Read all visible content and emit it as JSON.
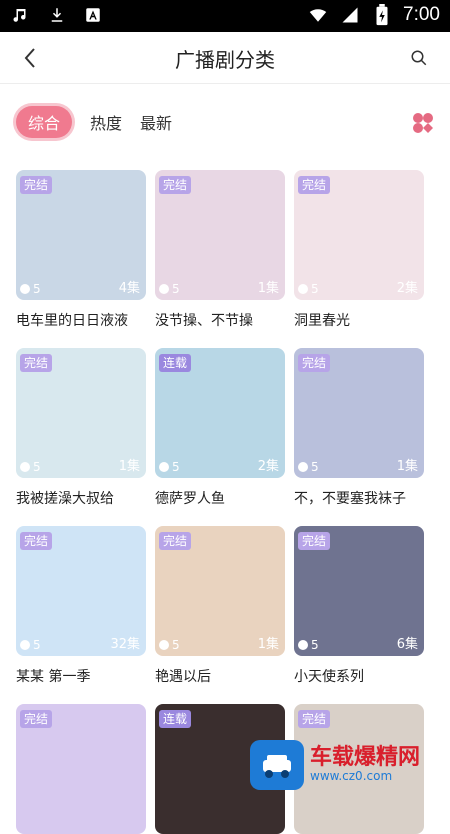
{
  "status": {
    "time": "7:00"
  },
  "header": {
    "title": "广播剧分类"
  },
  "tabs": [
    {
      "label": "综合",
      "active": true
    },
    {
      "label": "热度",
      "active": false
    },
    {
      "label": "最新",
      "active": false
    }
  ],
  "items": [
    {
      "title": "电车里的日日液液",
      "status": "完结",
      "rating": "5",
      "episodes": "4集",
      "color": "#c9d7e6"
    },
    {
      "title": "没节操、不节操",
      "status": "完结",
      "rating": "5",
      "episodes": "1集",
      "color": "#e8d7e4"
    },
    {
      "title": "洞里春光",
      "status": "完结",
      "rating": "5",
      "episodes": "2集",
      "color": "#f2e3e8"
    },
    {
      "title": "我被搓澡大叔给",
      "status": "完结",
      "rating": "5",
      "episodes": "1集",
      "color": "#d8e8ee"
    },
    {
      "title": "德萨罗人鱼",
      "status": "连载",
      "rating": "5",
      "episodes": "2集",
      "color": "#b8d7e6"
    },
    {
      "title": "不，不要塞我袜子",
      "status": "完结",
      "rating": "5",
      "episodes": "1集",
      "color": "#b9c0dc"
    },
    {
      "title": "某某 第一季",
      "status": "完结",
      "rating": "5",
      "episodes": "32集",
      "color": "#cfe4f6"
    },
    {
      "title": "艳遇以后",
      "status": "完结",
      "rating": "5",
      "episodes": "1集",
      "color": "#e9d3bf"
    },
    {
      "title": "小天使系列",
      "status": "完结",
      "rating": "5",
      "episodes": "6集",
      "color": "#6f7390"
    },
    {
      "title": "",
      "status": "完结",
      "rating": "",
      "episodes": "",
      "color": "#d7c9ef"
    },
    {
      "title": "",
      "status": "连载",
      "rating": "",
      "episodes": "",
      "color": "#3a2e2e"
    },
    {
      "title": "",
      "status": "完结",
      "rating": "",
      "episodes": "",
      "color": "#d9d0c8"
    }
  ],
  "watermark": {
    "main": "车载爆精网",
    "sub": "www.cz0.com"
  }
}
